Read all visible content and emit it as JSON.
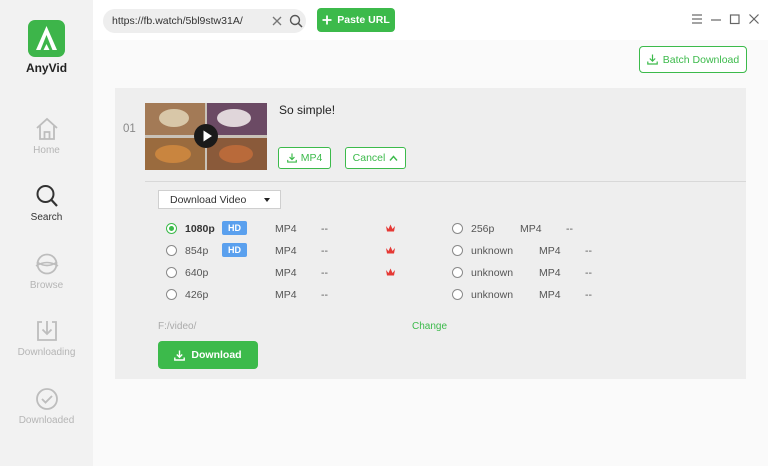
{
  "app": {
    "name": "AnyVid"
  },
  "sidebar": {
    "items": [
      {
        "label": "Home",
        "icon": "home-icon",
        "active": false
      },
      {
        "label": "Search",
        "icon": "search-icon",
        "active": true
      },
      {
        "label": "Browse",
        "icon": "browse-icon",
        "active": false
      },
      {
        "label": "Downloading",
        "icon": "downloading-icon",
        "active": false
      },
      {
        "label": "Downloaded",
        "icon": "downloaded-icon",
        "active": false
      }
    ]
  },
  "topbar": {
    "url_value": "https://fb.watch/5bl9stw31A/",
    "paste_label": "Paste URL"
  },
  "content": {
    "batch_label": "Batch Download",
    "item": {
      "index": "01",
      "title": "So simple!",
      "format_button": "MP4",
      "cancel_button": "Cancel",
      "type_select": "Download Video",
      "options_left": [
        {
          "res": "1080p",
          "hd": "HD",
          "format": "MP4",
          "size": "--",
          "premium": true,
          "selected": true
        },
        {
          "res": "854p",
          "hd": "HD",
          "format": "MP4",
          "size": "--",
          "premium": true,
          "selected": false
        },
        {
          "res": "640p",
          "hd": "",
          "format": "MP4",
          "size": "--",
          "premium": true,
          "selected": false
        },
        {
          "res": "426p",
          "hd": "",
          "format": "MP4",
          "size": "--",
          "premium": false,
          "selected": false
        }
      ],
      "options_right": [
        {
          "res": "256p",
          "format": "MP4",
          "size": "--"
        },
        {
          "res": "unknown",
          "format": "MP4",
          "size": "--"
        },
        {
          "res": "unknown",
          "format": "MP4",
          "size": "--"
        },
        {
          "res": "unknown",
          "format": "MP4",
          "size": "--"
        }
      ],
      "save_path": "F:/video/",
      "change_label": "Change",
      "download_label": "Download"
    }
  },
  "colors": {
    "accent": "#3cba4b",
    "hd_badge": "#5aa0ee",
    "crown": "#e53935",
    "sidebar_bg": "#f2f2f2"
  }
}
